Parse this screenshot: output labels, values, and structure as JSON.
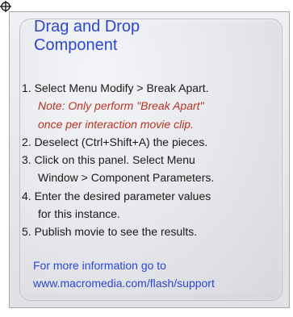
{
  "panel": {
    "title_line1": "Drag and Drop",
    "title_line2": "Component",
    "steps": [
      "1. Select Menu Modify > Break Apart.",
      "Note: Only perform \"Break Apart\"",
      "once per interaction movie clip.",
      "2. Deselect (Ctrl+Shift+A) the pieces.",
      "3. Click on this panel. Select Menu",
      "Window > Component Parameters.",
      "4. Enter the desired parameter values",
      "for this instance.",
      "5. Publish movie to see the results."
    ],
    "footer_line1": "For more information go to",
    "footer_line2": "www.macromedia.com/flash/support"
  },
  "colors": {
    "title": "#2c46d6",
    "note": "#b8331f",
    "body_text": "#1a1a1a",
    "link": "#2c46d6"
  },
  "icons": {
    "registration": "registration-crosshair-icon"
  }
}
